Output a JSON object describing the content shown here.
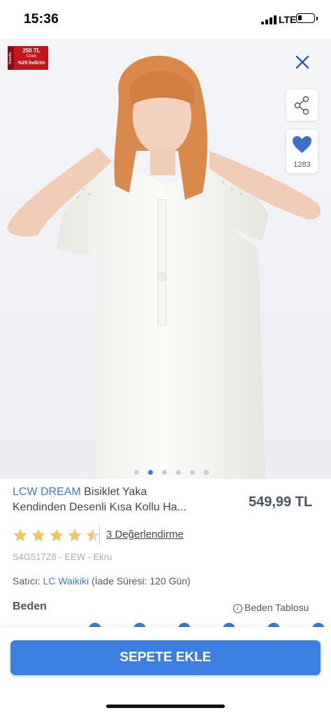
{
  "status_bar": {
    "time": "15:36",
    "network": "LTE"
  },
  "promo_badge": {
    "side": "Sepette",
    "line1": "250 TL",
    "line2": "Üzeri",
    "line3": "%25 İndirim"
  },
  "gallery": {
    "dot_count": 6,
    "active_index": 1
  },
  "favorites": {
    "count": "1283"
  },
  "product": {
    "brand": "LCW DREAM",
    "name_line1": " Bisiklet Yaka",
    "name_line2": "Kendinden Desenli Kısa Kollu Ha...",
    "price": "549,99 TL",
    "rating": 4.5,
    "reviews_label": "3 Değerlendirme",
    "sku": "S4G517Z8 - EEW - Ekru",
    "seller_prefix": "Satıcı: ",
    "seller_name": "LC Waikiki",
    "seller_suffix": " (İade Süresi: 120 Gün)"
  },
  "size": {
    "label": "Beden",
    "table_label": "Beden Tablosu"
  },
  "actions": {
    "add_to_cart": "SEPETE EKLE"
  },
  "colors": {
    "accent": "#3d7fe0",
    "brand_text": "#3a7bd5",
    "star": "#f2c26b",
    "promo": "#c4161c"
  }
}
